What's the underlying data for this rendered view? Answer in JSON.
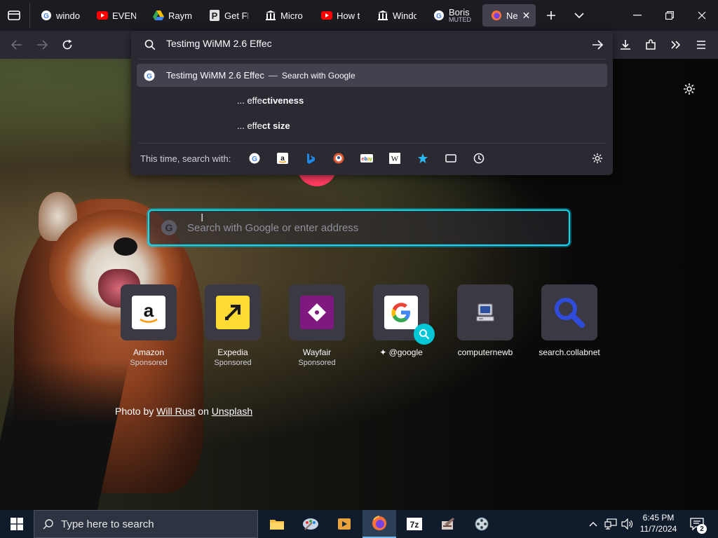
{
  "tabs": [
    {
      "title": "windo",
      "favicon": "google-icon"
    },
    {
      "title": "EVEN I",
      "favicon": "youtube-icon"
    },
    {
      "title": "Rayma",
      "favicon": "google-drive-icon"
    },
    {
      "title": "Get FR",
      "favicon": "p-icon"
    },
    {
      "title": "Micro",
      "favicon": "columns-icon"
    },
    {
      "title": "How t",
      "favicon": "youtube-icon"
    },
    {
      "title": "Windo",
      "favicon": "columns-icon"
    },
    {
      "title": "Boris I",
      "sub": "MUTED",
      "favicon": "google-icon"
    },
    {
      "title": "Ne",
      "favicon": "firefox-icon",
      "active": true
    }
  ],
  "urlbar": {
    "value": "Testimg WiMM 2.6 Effec"
  },
  "suggestions": [
    {
      "text": "Testimg WiMM 2.6 Effec",
      "dash": "—",
      "action": "Search with Google"
    },
    {
      "prefix": "... effe",
      "bold": "ctiveness"
    },
    {
      "prefix": "... effe",
      "bold": "ct size"
    }
  ],
  "oneoff": {
    "label": "This time, search with:",
    "engines": [
      "google",
      "amazon",
      "bing",
      "duckduckgo",
      "ebay",
      "wikipedia",
      "bookmarks",
      "tabs",
      "history"
    ]
  },
  "newtab": {
    "search_placeholder": "Search with Google or enter address",
    "tiles": [
      {
        "name": "Amazon",
        "sponsored": "Sponsored"
      },
      {
        "name": "Expedia",
        "sponsored": "Sponsored"
      },
      {
        "name": "Wayfair",
        "sponsored": "Sponsored"
      },
      {
        "name": "@google",
        "sponsored": ""
      },
      {
        "name": "computernewb",
        "sponsored": ""
      },
      {
        "name": "search.collabnet",
        "sponsored": ""
      }
    ],
    "credit_prefix": "Photo by",
    "credit_author": "Will Rust",
    "credit_mid": "on",
    "credit_site": "Unsplash"
  },
  "taskbar": {
    "search_placeholder": "Type here to search",
    "time": "6:45 PM",
    "date": "11/7/2024",
    "notifications": "2"
  },
  "colors": {
    "accent": "#00ddff",
    "panel": "#2b2a33",
    "taskbar": "#101c2c"
  }
}
